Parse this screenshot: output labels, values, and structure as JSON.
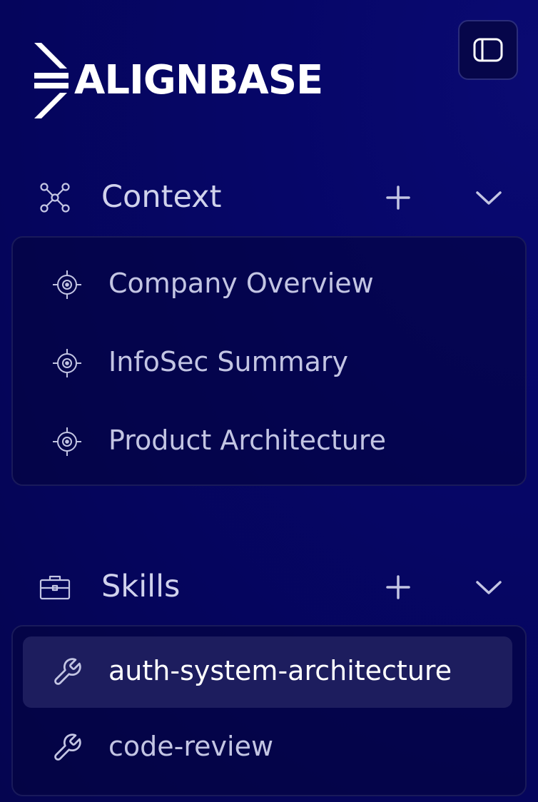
{
  "brand": {
    "name": "ALIGNBASE"
  },
  "header": {
    "toggle_icon": "sidebar-toggle-icon"
  },
  "sections": [
    {
      "title": "Context",
      "icon": "network-nodes-icon",
      "add_icon": "plus-icon",
      "collapse_icon": "chevron-down-icon",
      "items": [
        {
          "label": "Company Overview",
          "icon": "target-icon",
          "active": false
        },
        {
          "label": "InfoSec Summary",
          "icon": "target-icon",
          "active": false
        },
        {
          "label": "Product Architecture",
          "icon": "target-icon",
          "active": false
        }
      ]
    },
    {
      "title": "Skills",
      "icon": "briefcase-icon",
      "add_icon": "plus-icon",
      "collapse_icon": "chevron-down-icon",
      "items": [
        {
          "label": "auth-system-architecture",
          "icon": "wrench-icon",
          "active": true
        },
        {
          "label": "code-review",
          "icon": "wrench-icon",
          "active": false
        }
      ]
    }
  ],
  "colors": {
    "background": "#05055c",
    "active_item": "#1d1d5e",
    "text": "#c3c5e3",
    "text_active": "#ffffff"
  }
}
